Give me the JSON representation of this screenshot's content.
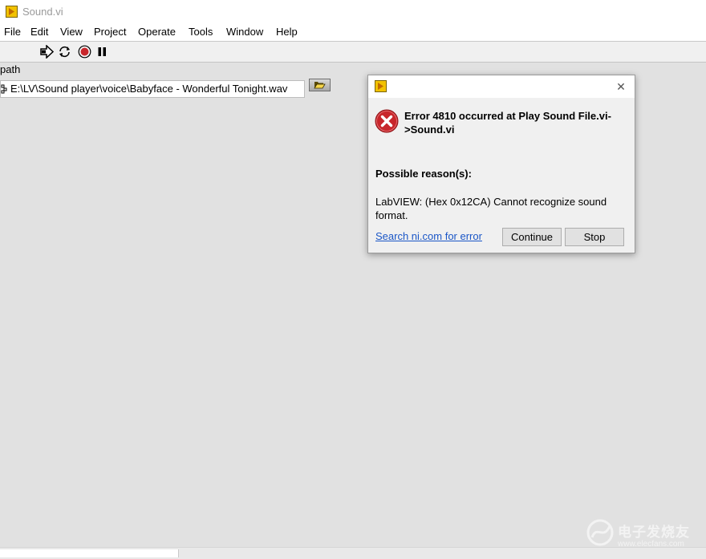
{
  "window": {
    "title": "Sound.vi"
  },
  "menubar": {
    "items": [
      "File",
      "Edit",
      "View",
      "Project",
      "Operate",
      "Tools",
      "Window",
      "Help"
    ]
  },
  "toolbar": {
    "tools": [
      "run-arrow-icon",
      "run-continuously-icon",
      "abort-execution-icon",
      "pause-icon"
    ]
  },
  "front_panel": {
    "path_label": "path",
    "path_value": "E:\\LV\\Sound player\\voice\\Babyface - Wonderful Tonight.wav"
  },
  "dialog": {
    "error_title": "Error 4810 occurred at Play Sound File.vi->Sound.vi",
    "reason_heading": "Possible reason(s):",
    "reason_text": "LabVIEW:  (Hex 0x12CA) Cannot recognize sound format.",
    "search_link": "Search ni.com for error",
    "continue_label": "Continue",
    "stop_label": "Stop",
    "close_glyph": "✕"
  },
  "watermark": {
    "text": "电子发烧友",
    "sub": "www.elecfans.com"
  },
  "colors": {
    "link": "#1a56c7",
    "error_red": "#c8262b",
    "labview_yellow": "#f2c200"
  }
}
